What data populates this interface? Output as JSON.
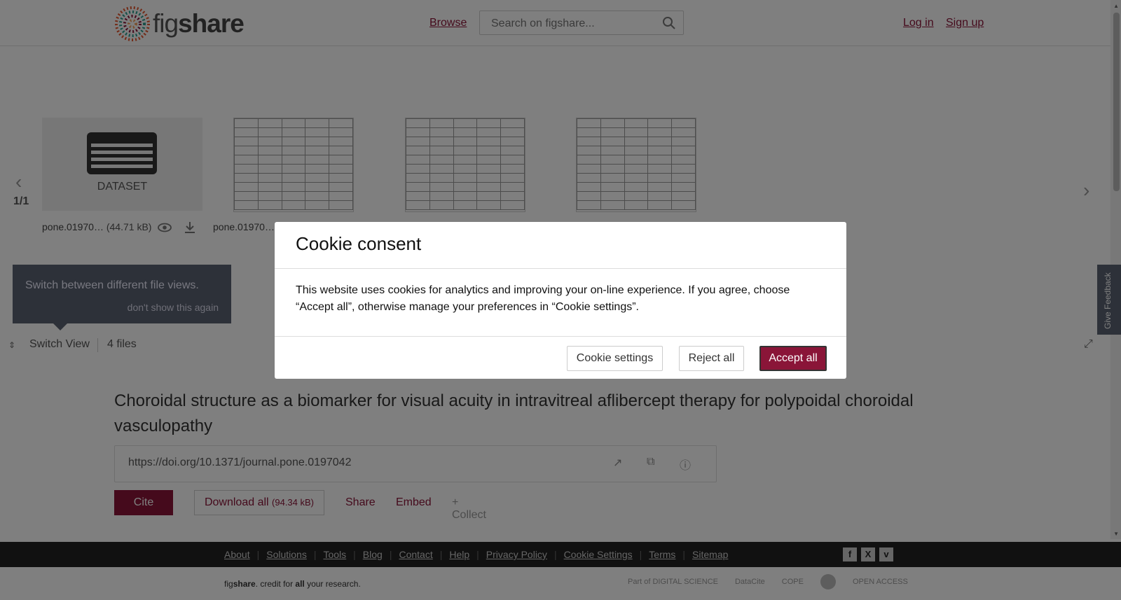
{
  "header": {
    "logo_text_fig": "fig",
    "logo_text_share": "share",
    "browse": "Browse",
    "search_placeholder": "Search on figshare...",
    "login": "Log in",
    "signup": "Sign up"
  },
  "viewer": {
    "counter": "1/1",
    "dataset_label": "DATASET",
    "files": [
      {
        "name": "pone.01970…",
        "size": "(44.71 kB)"
      },
      {
        "name": "pone.01970…"
      }
    ],
    "tooltip_text": "Switch between different file views.",
    "tooltip_dismiss": "don't show this again",
    "switch_view": "Switch View",
    "files_count": "4 files",
    "feedback": "Give Feedback"
  },
  "article": {
    "title": "Choroidal structure as a biomarker for visual acuity in intravitreal aflibercept therapy for polypoidal choroidal vasculopathy",
    "doi": "https://doi.org/10.1371/journal.pone.0197042",
    "cite": "Cite",
    "download_all": "Download all",
    "download_size": "(94.34 kB)",
    "share": "Share",
    "embed": "Embed",
    "collect": "+ Collect"
  },
  "footer": {
    "links": [
      "About",
      "Solutions",
      "Tools",
      "Blog",
      "Contact",
      "Help",
      "Privacy Policy",
      "Cookie Settings",
      "Terms",
      "Sitemap"
    ],
    "credit_fig": "fig",
    "credit_share": "share",
    "credit_mid": ". credit for ",
    "credit_all": "all",
    "credit_end": " your research.",
    "partners": [
      "Part of DIGITAL SCIENCE",
      "DataCite",
      "COPE",
      "",
      "OPEN ACCESS"
    ]
  },
  "modal": {
    "title": "Cookie consent",
    "body": "This website uses cookies for analytics and improving your on-line experience. If you agree, choose “Accept all”, otherwise manage your preferences in “Cookie settings”.",
    "settings": "Cookie settings",
    "reject": "Reject all",
    "accept": "Accept all"
  },
  "colors": {
    "brand": "#8a1538",
    "tooltip": "#5a6372",
    "footer_dark": "#222222"
  }
}
